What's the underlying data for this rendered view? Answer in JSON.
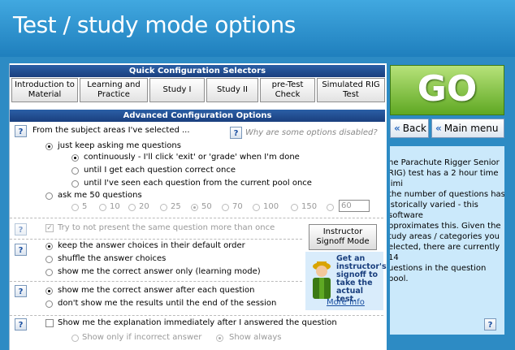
{
  "header": {
    "title": "Test / study mode options"
  },
  "quick": {
    "title": "Quick Configuration Selectors",
    "buttons": [
      {
        "l1": "Introduction to",
        "l2": "Material"
      },
      {
        "l1": "Learning and",
        "l2": "Practice"
      },
      {
        "l1": "Study I",
        "l2": ""
      },
      {
        "l1": "Study II",
        "l2": ""
      },
      {
        "l1": "pre-Test",
        "l2": "Check"
      },
      {
        "l1": "Simulated RIG",
        "l2": "Test"
      }
    ]
  },
  "advanced": {
    "title": "Advanced Configuration Options",
    "help_glyph": "?",
    "subject_label": "From the subject areas I've selected ...",
    "why_disabled": "Why are some options disabled?",
    "keep_asking": "just keep asking me questions",
    "continuously": "continuously - I'll click 'exit' or 'grade' when I'm done",
    "until_correct": "until I get each question correct once",
    "until_seen": "until I've seen each question from the current pool once",
    "ask_me": "ask me 50 questions",
    "counts": [
      "5",
      "10",
      "20",
      "25",
      "50",
      "70",
      "100",
      "150"
    ],
    "custom_count": "60",
    "not_present_same": "Try to not present the same question more than once",
    "keep_order": "keep the answer choices in their default order",
    "shuffle": "shuffle the answer choices",
    "show_correct_only": "show me the correct answer only (learning mode)",
    "show_after_each": "show me the correct answer after each question",
    "dont_show": "don't show me the results until the end of the session",
    "show_explanation": "Show me the explanation immediately after I answered the question",
    "show_if_incorrect": "Show only if incorrect answer",
    "show_always": "Show always"
  },
  "instructor": {
    "l1": "Instructor",
    "l2": "Signoff Mode",
    "promo": "Get an instructor's signoff to take the actual test.",
    "more_info": "More Info"
  },
  "side": {
    "go": "GO",
    "back": "Back",
    "main_menu": "Main menu",
    "info_text": "he Parachute Rigger Senior\nRIG) test has a 2 hour time limi\n the number of questions has\nistorically varied - this software\npproximates this.  Given the\ntudy areas / categories you\nelected, there are currently 14\nuestions in the question pool.",
    "help_glyph": "?"
  },
  "colors": {
    "accent": "#2d8bc4",
    "go_green": "#5fa823",
    "bar_blue": "#1a3f7e"
  }
}
